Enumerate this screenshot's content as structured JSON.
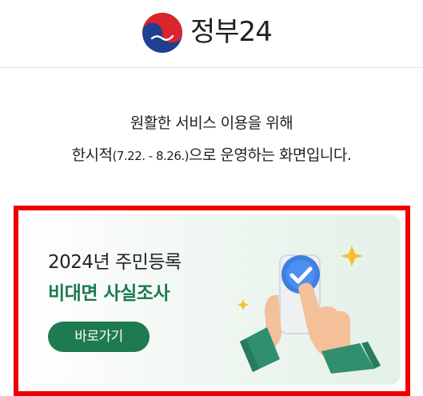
{
  "header": {
    "brand_name": "정부24"
  },
  "notice": {
    "line1": "원활한 서비스 이용을 위해",
    "line2_prefix": "한시적",
    "line2_period": "(7.22. - 8.26.)",
    "line2_suffix": "으로 운영하는 화면입니다."
  },
  "banner": {
    "title": "2024년 주민등록",
    "subtitle": "비대면 사실조사",
    "button_label": "바로가기"
  },
  "colors": {
    "accent_green": "#1e7a50",
    "highlight_red": "#ee0000"
  }
}
